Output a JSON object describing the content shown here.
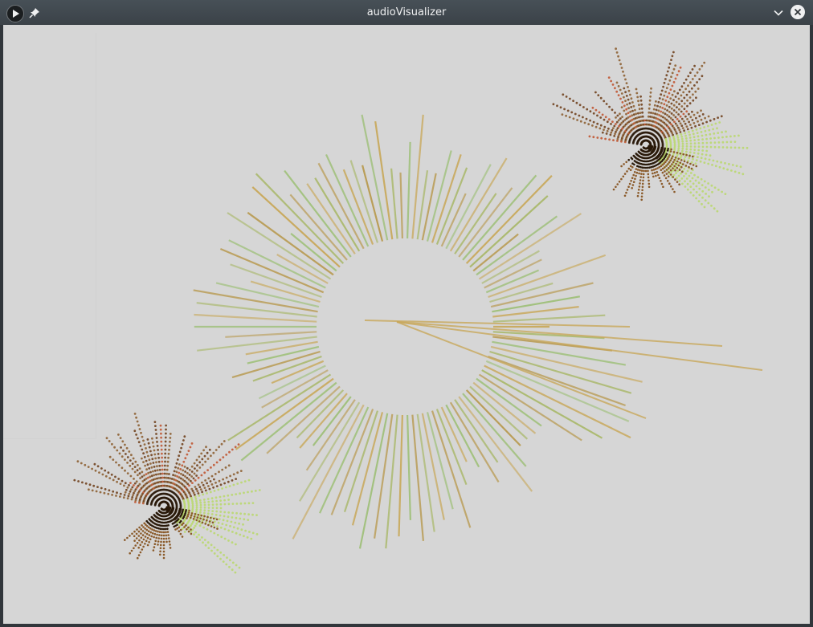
{
  "window": {
    "title": "audioVisualizer",
    "app_icon": "play-icon",
    "pin_icon": "pin-icon",
    "minimize_icon": "chevron-down-icon",
    "close_icon": "close-icon"
  },
  "visualizer": {
    "background_color": "#d6d6d6",
    "ring_colors": [
      "#c8a85a",
      "#a9b86a",
      "#b89a50",
      "#9fc07a"
    ],
    "burst_colors": [
      "#2a1a0a",
      "#6b3a14",
      "#8a5a2a",
      "#c0502a",
      "#3a8a2a",
      "#b8d86a"
    ]
  }
}
